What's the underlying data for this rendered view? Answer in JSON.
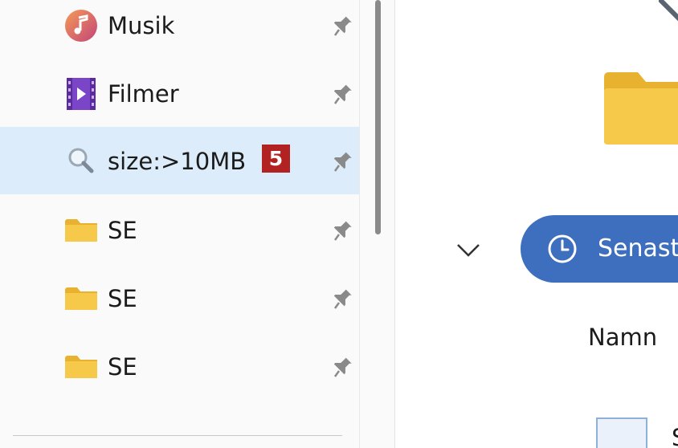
{
  "sidebar": {
    "items": [
      {
        "label": "Musik",
        "icon": "music-icon",
        "pinned": true
      },
      {
        "label": "Filmer",
        "icon": "video-icon",
        "pinned": true
      },
      {
        "label": "size:>10MB",
        "icon": "search-icon",
        "pinned": true,
        "selected": true,
        "badge": "5"
      },
      {
        "label": "SE",
        "icon": "folder-icon",
        "pinned": true
      },
      {
        "label": "SE",
        "icon": "folder-icon",
        "pinned": true
      },
      {
        "label": "SE",
        "icon": "folder-icon",
        "pinned": true
      }
    ]
  },
  "main": {
    "section_label": "Senast",
    "column_header": "Namn",
    "row_partial": "S"
  },
  "colors": {
    "selected_bg": "#dcecfa",
    "accent_pill": "#3d6fbe",
    "badge": "#b22222",
    "folder": "#f6c94b"
  }
}
